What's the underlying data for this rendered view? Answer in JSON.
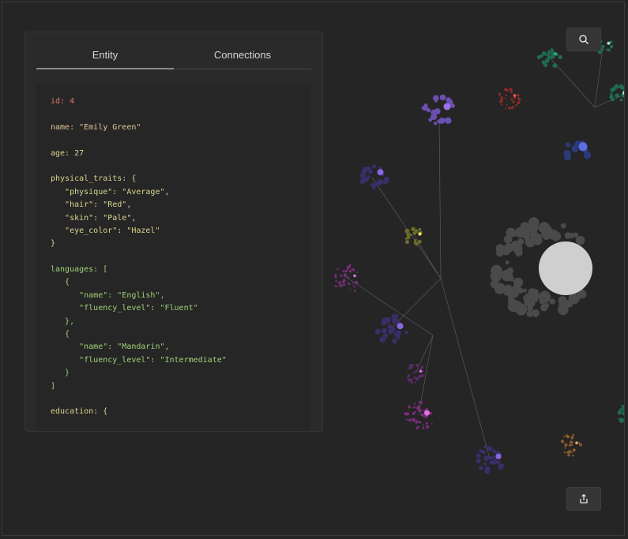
{
  "tabs": [
    {
      "label": "Entity",
      "active": true
    },
    {
      "label": "Connections",
      "active": false
    }
  ],
  "entity_lines": [
    {
      "text": "id: 4",
      "color": "#e07b6f"
    },
    {
      "text": "",
      "color": "#e3c495"
    },
    {
      "text": "name: \"Emily Green\"",
      "color": "#e3c495"
    },
    {
      "text": "",
      "color": "#e3c495"
    },
    {
      "text": "age: 27",
      "color": "#d8d48c"
    },
    {
      "text": "",
      "color": "#e3c495"
    },
    {
      "text": "physical_traits: {",
      "color": "#d8d48c"
    },
    {
      "text": "   \"physique\": \"Average\",",
      "color": "#d8d48c"
    },
    {
      "text": "   \"hair\": \"Red\",",
      "color": "#d8d48c"
    },
    {
      "text": "   \"skin\": \"Pale\",",
      "color": "#d8d48c"
    },
    {
      "text": "   \"eye_color\": \"Hazel\"",
      "color": "#d8d48c"
    },
    {
      "text": "}",
      "color": "#d8d48c"
    },
    {
      "text": "",
      "color": "#e3c495"
    },
    {
      "text": "languages: [",
      "color": "#9fd178"
    },
    {
      "text": "   {",
      "color": "#9fd178"
    },
    {
      "text": "      \"name\": \"English\",",
      "color": "#9fd178"
    },
    {
      "text": "      \"fluency_level\": \"Fluent\"",
      "color": "#9fd178"
    },
    {
      "text": "   },",
      "color": "#9fd178"
    },
    {
      "text": "   {",
      "color": "#9fd178"
    },
    {
      "text": "      \"name\": \"Mandarin\",",
      "color": "#9fd178"
    },
    {
      "text": "      \"fluency_level\": \"Intermediate\"",
      "color": "#9fd178"
    },
    {
      "text": "   }",
      "color": "#9fd178"
    },
    {
      "text": "]",
      "color": "#9fd178"
    },
    {
      "text": "",
      "color": "#e3c495"
    },
    {
      "text": "education: {",
      "color": "#d8d48c"
    }
  ],
  "buttons": {
    "search_icon": "search-icon",
    "share_icon": "share-icon"
  },
  "colors": {
    "background": "#252525",
    "panel": "#2a2a2a",
    "purple": "#6b4fb0",
    "green": "#1f6b50",
    "red": "#8c2a2a",
    "blue": "#5a6fe0",
    "olive": "#6d6d2a",
    "magenta": "#7a2d7a",
    "orange": "#8a5a2a",
    "gray": "#4a4a4a",
    "hub": "#cfcfcf",
    "edge": "#5a5a5a"
  }
}
